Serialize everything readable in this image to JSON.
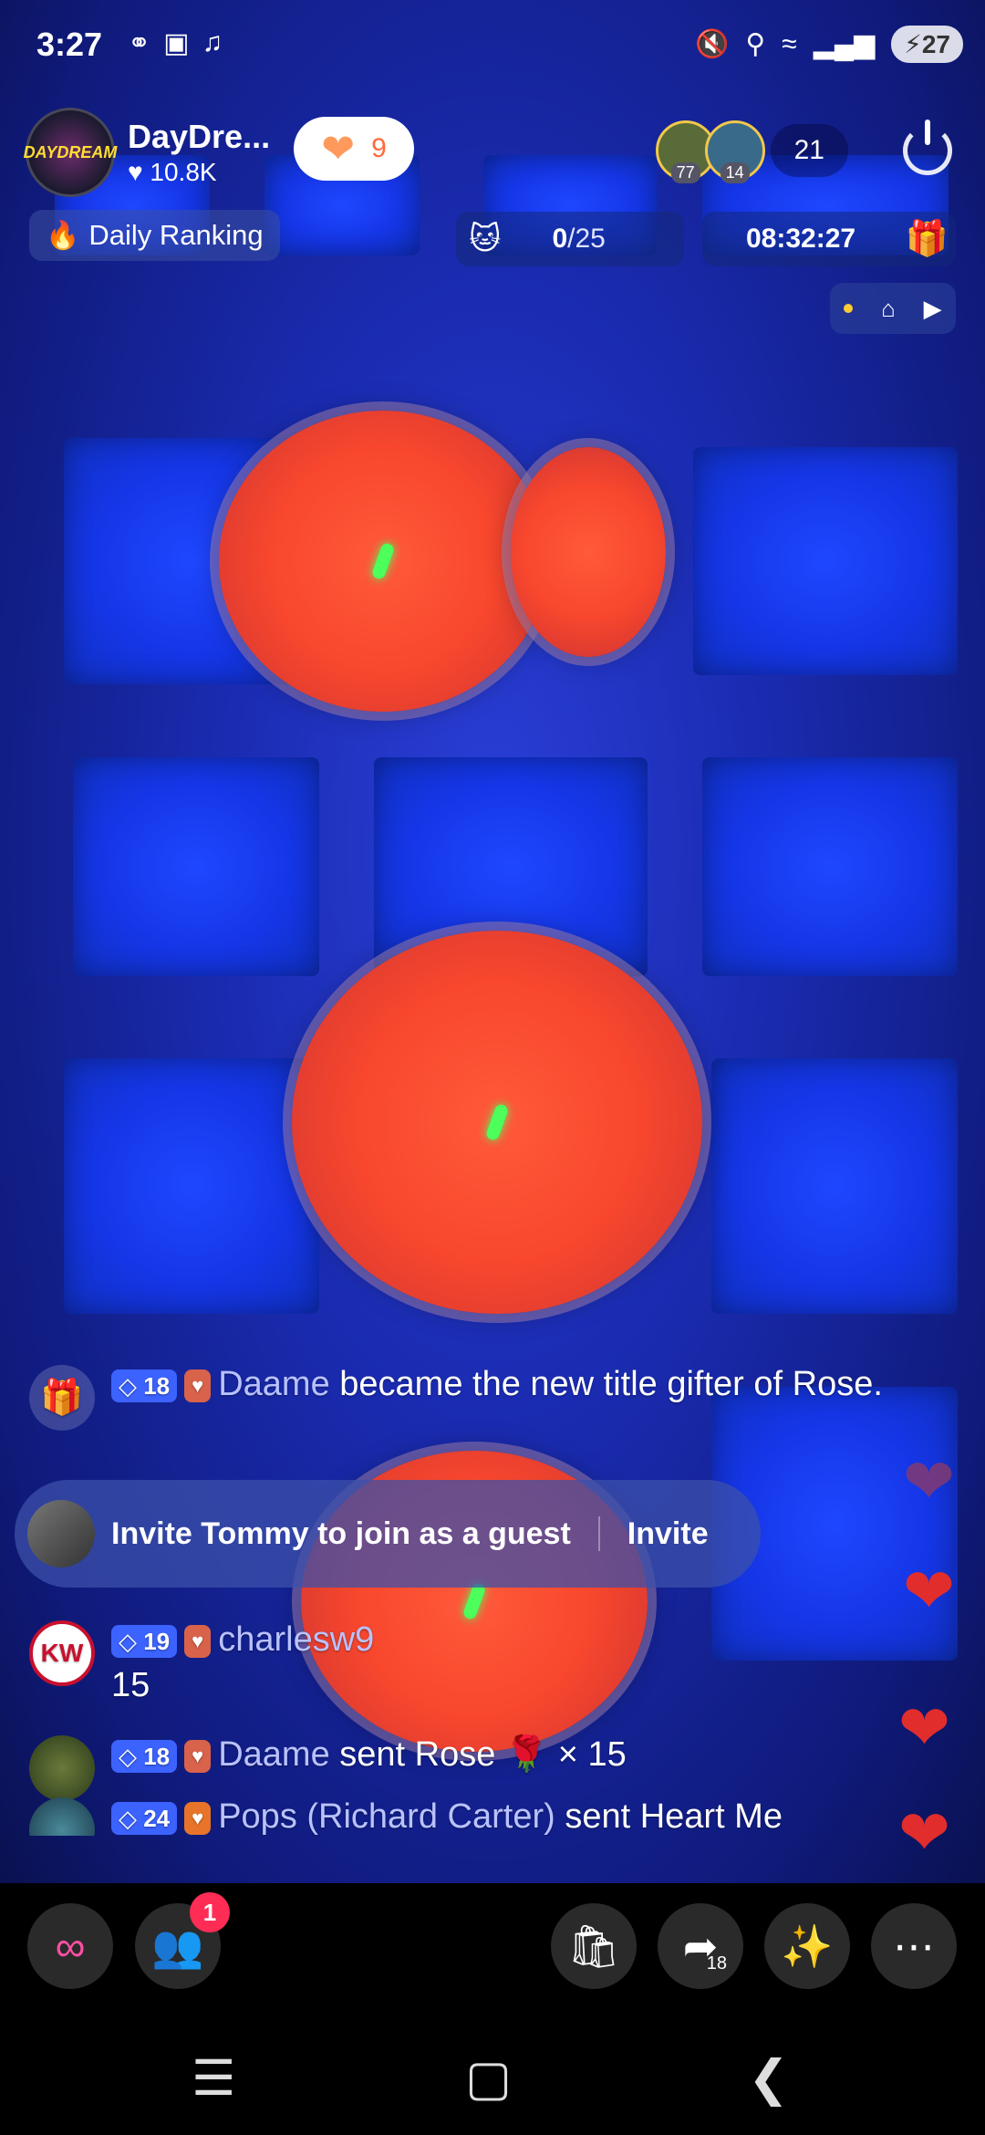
{
  "status_bar": {
    "time": "3:27",
    "battery": "27",
    "wifi_label": "6"
  },
  "host": {
    "name": "DayDre...",
    "likes": "10.8K",
    "avatar_text": "DAYDREAM"
  },
  "like_pill": {
    "count": "9"
  },
  "viewers": {
    "badges": [
      "77",
      "14"
    ],
    "count": "21"
  },
  "ranking": {
    "label": "Daily Ranking"
  },
  "goal": {
    "current": "0",
    "total": "/25"
  },
  "timer": {
    "value": "08:32:27"
  },
  "chat": {
    "messages": [
      {
        "level": "18",
        "user": "Daame",
        "text": " became the new title gifter of Rose."
      },
      {
        "level": "19",
        "user": "charlesw9",
        "text": "15",
        "avatar_text": "KW"
      },
      {
        "level": "18",
        "user": "Daame",
        "text": " sent Rose 🌹 × 15"
      },
      {
        "level": "24",
        "user": "Pops (Richard Carter)",
        "text": " sent Heart Me"
      }
    ],
    "invite": {
      "text": "Invite Tommy to join as a guest",
      "button": "Invite"
    }
  },
  "bottom_bar": {
    "friends_notification": "1",
    "share_count": "18"
  },
  "colors": {
    "accent": "#3c63ff",
    "notification": "#ff2d55",
    "background_blue": "#1536e6"
  }
}
